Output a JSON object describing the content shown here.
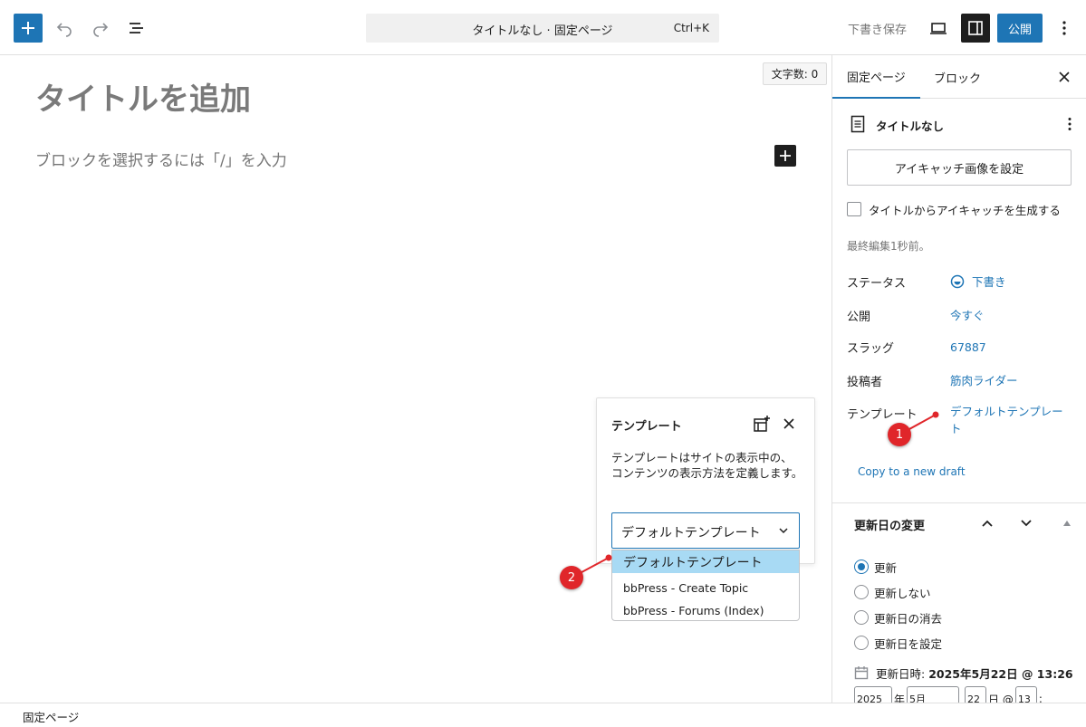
{
  "toolbar": {
    "add_label": "+",
    "document_title": "タイトルなし · 固定ページ",
    "shortcut": "Ctrl+K",
    "save_draft": "下書き保存",
    "publish": "公開"
  },
  "editor": {
    "word_count": "文字数: 0",
    "title_placeholder": "タイトルを追加",
    "block_placeholder": "ブロックを選択するには「/」を入力"
  },
  "template_popover": {
    "title": "テンプレート",
    "description": "テンプレートはサイトの表示中の、コンテンツの表示方法を定義します。",
    "selected": "デフォルトテンプレート",
    "options": [
      "デフォルトテンプレート",
      "bbPress - Create Topic",
      "bbPress - Forums (Index)"
    ]
  },
  "annotations": [
    "1",
    "2"
  ],
  "sidebar": {
    "tabs": [
      "固定ページ",
      "ブロック"
    ],
    "doc_title": "タイトルなし",
    "featured_button": "アイキャッチ画像を設定",
    "generate_checkbox": "タイトルからアイキャッチを生成する",
    "last_edited": "最終編集1秒前。",
    "meta": {
      "status_label": "ステータス",
      "status_value": "下書き",
      "publish_label": "公開",
      "publish_value": "今すぐ",
      "slug_label": "スラッグ",
      "slug_value": "67887",
      "author_label": "投稿者",
      "author_value": "筋肉ライダー",
      "template_label": "テンプレート",
      "template_value": "デフォルトテンプレート"
    },
    "copy_draft": "Copy to a new draft",
    "update_panel": {
      "title": "更新日の変更",
      "options": [
        "更新",
        "更新しない",
        "更新日の消去",
        "更新日を設定"
      ],
      "selected_index": 0,
      "date_label": "更新日時:",
      "date_value": "2025年5月22日 @ 13:26",
      "inputs": {
        "year": "2025",
        "year_unit": "年",
        "month": "5月",
        "day": "22",
        "day_unit": "日 @",
        "hour": "13",
        "colon": ":"
      }
    }
  },
  "footer": {
    "breadcrumb": "固定ページ"
  },
  "colors": {
    "accent": "#1e75b5",
    "marker": "#e0262a",
    "highlight": "#a8daf4"
  }
}
